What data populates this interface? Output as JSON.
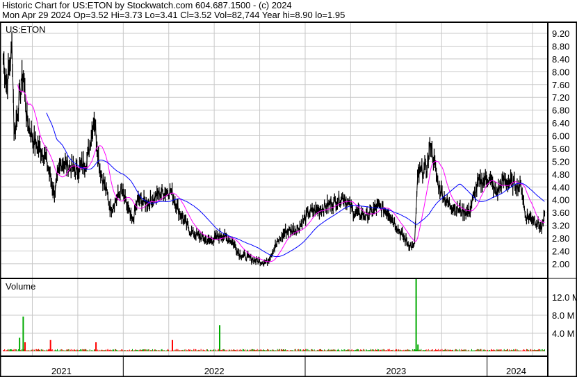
{
  "header": {
    "title": "Historic Chart for US:ETON by Stockwatch.com 604.687.1500 - (c) 2024",
    "quote": "Mon Apr 29 2024  Op=3.52  Hi=3.73  Lo=3.41  Cl=3.52  Vol=82,744  Year hi=8.90  lo=1.95"
  },
  "chart_data": {
    "type": "line",
    "symbol_label": "US:ETON",
    "volume_label": "Volume",
    "x_range": [
      2021.33,
      2024.33
    ],
    "x_tick_labels": [
      {
        "label": "2021",
        "year": 2021.66
      },
      {
        "label": "2022",
        "year": 2022.5
      },
      {
        "label": "2023",
        "year": 2023.5
      },
      {
        "label": "2024",
        "year": 2024.16
      }
    ],
    "year_boundaries": [
      2022,
      2023,
      2024
    ],
    "price_ticks": [
      "9.20",
      "8.80",
      "8.40",
      "8.00",
      "7.60",
      "7.20",
      "6.80",
      "6.40",
      "6.00",
      "5.60",
      "5.20",
      "4.80",
      "4.40",
      "4.00",
      "3.60",
      "3.20",
      "2.80",
      "2.40",
      "2.00"
    ],
    "volume_ticks": [
      {
        "label": "12.0 M",
        "value": 12
      },
      {
        "label": "8.0 M",
        "value": 8
      },
      {
        "label": "4.0 M",
        "value": 4
      }
    ],
    "price_series": {
      "name": "Close",
      "points": [
        [
          2021.34,
          8.4
        ],
        [
          2021.36,
          7.6
        ],
        [
          2021.39,
          8.8
        ],
        [
          2021.4,
          6.0
        ],
        [
          2021.45,
          8.0
        ],
        [
          2021.47,
          6.5
        ],
        [
          2021.51,
          5.8
        ],
        [
          2021.57,
          5.4
        ],
        [
          2021.62,
          4.2
        ],
        [
          2021.66,
          5.2
        ],
        [
          2021.74,
          4.9
        ],
        [
          2021.8,
          5.2
        ],
        [
          2021.84,
          6.6
        ],
        [
          2021.87,
          5.0
        ],
        [
          2021.91,
          4.2
        ],
        [
          2021.93,
          3.7
        ],
        [
          2021.99,
          4.3
        ],
        [
          2022.05,
          3.3
        ],
        [
          2022.08,
          4.0
        ],
        [
          2022.14,
          3.9
        ],
        [
          2022.2,
          4.2
        ],
        [
          2022.26,
          4.3
        ],
        [
          2022.31,
          3.6
        ],
        [
          2022.37,
          3.0
        ],
        [
          2022.47,
          2.7
        ],
        [
          2022.54,
          2.9
        ],
        [
          2022.6,
          2.7
        ],
        [
          2022.64,
          2.3
        ],
        [
          2022.73,
          2.1
        ],
        [
          2022.79,
          2.05
        ],
        [
          2022.83,
          2.5
        ],
        [
          2022.89,
          3.0
        ],
        [
          2022.96,
          3.1
        ],
        [
          2023.02,
          3.6
        ],
        [
          2023.08,
          3.7
        ],
        [
          2023.15,
          3.9
        ],
        [
          2023.21,
          4.1
        ],
        [
          2023.27,
          3.6
        ],
        [
          2023.34,
          3.5
        ],
        [
          2023.4,
          3.8
        ],
        [
          2023.46,
          3.6
        ],
        [
          2023.52,
          3.0
        ],
        [
          2023.57,
          2.6
        ],
        [
          2023.6,
          2.5
        ],
        [
          2023.62,
          4.8
        ],
        [
          2023.67,
          5.0
        ],
        [
          2023.69,
          5.8
        ],
        [
          2023.73,
          4.5
        ],
        [
          2023.78,
          3.9
        ],
        [
          2023.84,
          3.7
        ],
        [
          2023.9,
          3.6
        ],
        [
          2023.95,
          4.5
        ],
        [
          2024.01,
          4.7
        ],
        [
          2024.05,
          4.2
        ],
        [
          2024.09,
          4.6
        ],
        [
          2024.15,
          4.5
        ],
        [
          2024.19,
          4.4
        ],
        [
          2024.21,
          3.5
        ],
        [
          2024.26,
          3.4
        ],
        [
          2024.3,
          3.1
        ],
        [
          2024.32,
          3.52
        ]
      ]
    },
    "moving_averages": [
      {
        "name": "short MA",
        "window_days": 20,
        "color": "#ff00ff"
      },
      {
        "name": "long MA",
        "window_days": 60,
        "color": "#0000ff"
      }
    ],
    "volume_series": {
      "unit": "M",
      "spikes": [
        [
          2021.43,
          3.0,
          "up"
        ],
        [
          2021.45,
          7.7,
          "up"
        ],
        [
          2021.46,
          2.0,
          "down"
        ],
        [
          2021.6,
          2.5,
          "down"
        ],
        [
          2021.85,
          2.0,
          "down"
        ],
        [
          2022.27,
          2.5,
          "down"
        ],
        [
          2022.53,
          5.8,
          "up"
        ],
        [
          2023.61,
          16.0,
          "up"
        ],
        [
          2023.62,
          1.5,
          "up"
        ]
      ],
      "baseline": 0.3
    },
    "price_range": [
      2.0,
      9.2
    ],
    "volume_range": [
      0,
      16
    ],
    "colors": {
      "price": "#000000",
      "up": "#00aa00",
      "down": "#ff0000",
      "grid": "#c8c8c8"
    }
  }
}
